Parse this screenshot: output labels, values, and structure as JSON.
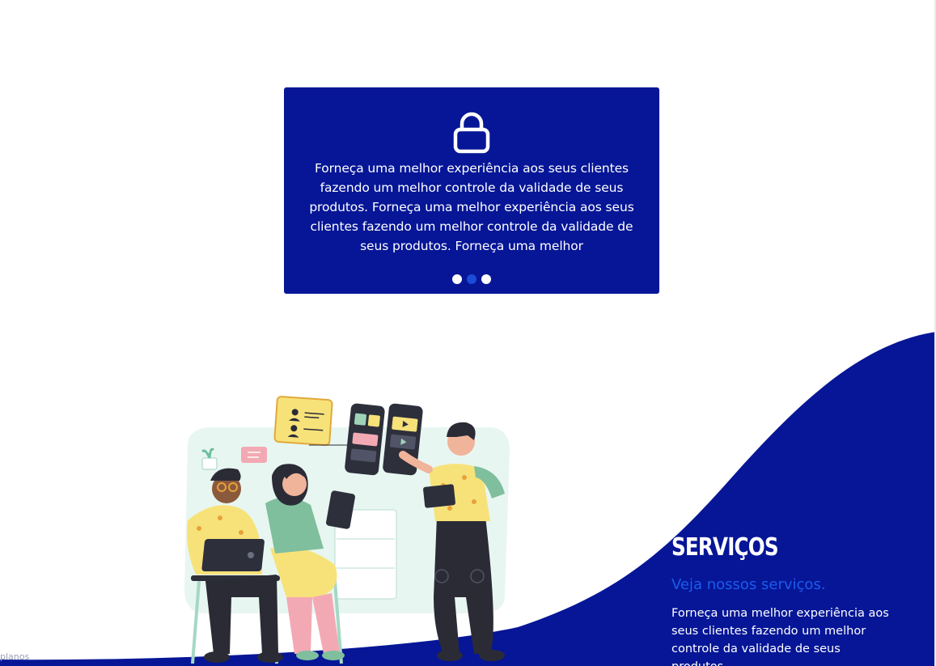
{
  "card": {
    "icon": "lock-icon",
    "text": "Forneça uma melhor experiência aos seus clientes fazendo um melhor controle da validade de seus produtos. Forneça uma melhor experiência aos seus clientes fazendo um melhor controle da validade de seus produtos. Forneça uma melhor",
    "dots": {
      "count": 3,
      "active_index": 1
    }
  },
  "services": {
    "title": "SERVIÇOS",
    "subtitle": "Veja nossos serviços.",
    "description": "Forneça uma melhor experiência aos seus clientes fazendo um melhor controle da validade de seus produtos."
  },
  "corner_label": "planos",
  "colors": {
    "brand_blue": "#061696",
    "accent_blue": "#1b5cf0",
    "dot_active": "#1c4bd8",
    "illustration_yellow": "#f7e27a"
  }
}
